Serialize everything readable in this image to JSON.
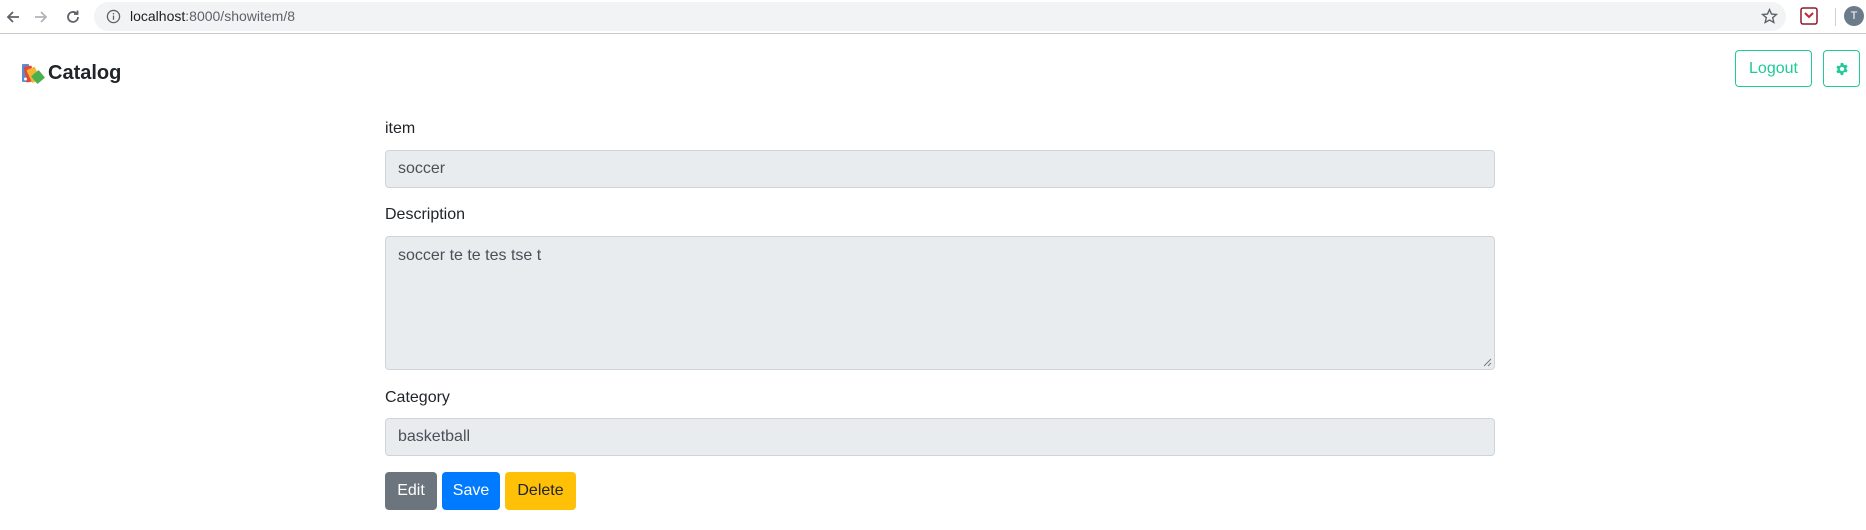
{
  "browser": {
    "url_host": "localhost",
    "url_path": ":8000/showitem/8",
    "profile_initial": "T"
  },
  "navbar": {
    "brand": "Catalog",
    "logout_label": "Logout",
    "settings_icon": "gear-icon"
  },
  "form": {
    "item_label": "item",
    "item_value": "soccer",
    "description_label": "Description",
    "description_value": "soccer te te tes tse t",
    "category_label": "Category",
    "category_value": "basketball"
  },
  "actions": {
    "edit_label": "Edit",
    "save_label": "Save",
    "delete_label": "Delete"
  },
  "colors": {
    "accent": "#20c997",
    "edit": "#6c757d",
    "save": "#007bff",
    "delete": "#ffc107"
  }
}
